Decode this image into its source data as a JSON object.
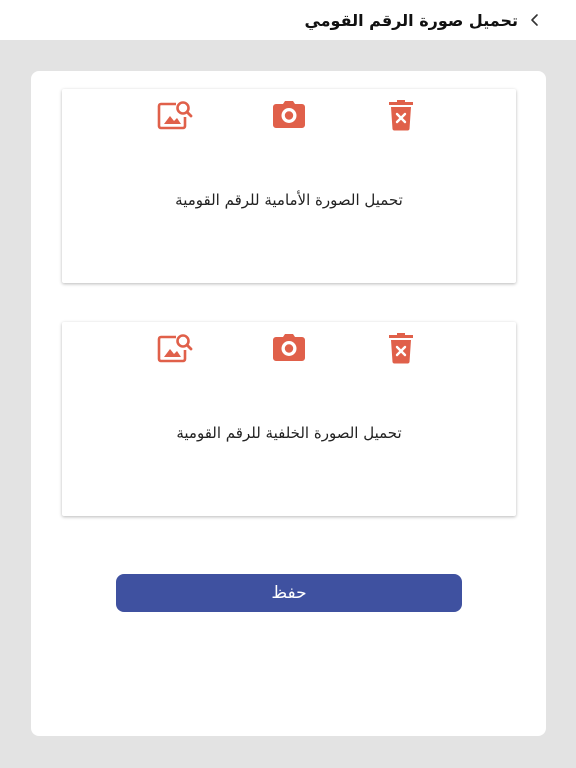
{
  "header": {
    "title": "تحميل صورة الرقم القومي",
    "back_icon": "chevron-left-icon"
  },
  "colors": {
    "accent_icon": "#e0604a",
    "primary_button": "#3f51a0",
    "background": "#e3e3e3"
  },
  "cards": [
    {
      "label": "تحميل الصورة الأمامية للرقم القومية",
      "icons": [
        "image-search-icon",
        "camera-icon",
        "delete-icon"
      ]
    },
    {
      "label": "تحميل الصورة الخلفية للرقم القومية",
      "icons": [
        "image-search-icon",
        "camera-icon",
        "delete-icon"
      ]
    }
  ],
  "save_button": {
    "label": "حفظ"
  }
}
